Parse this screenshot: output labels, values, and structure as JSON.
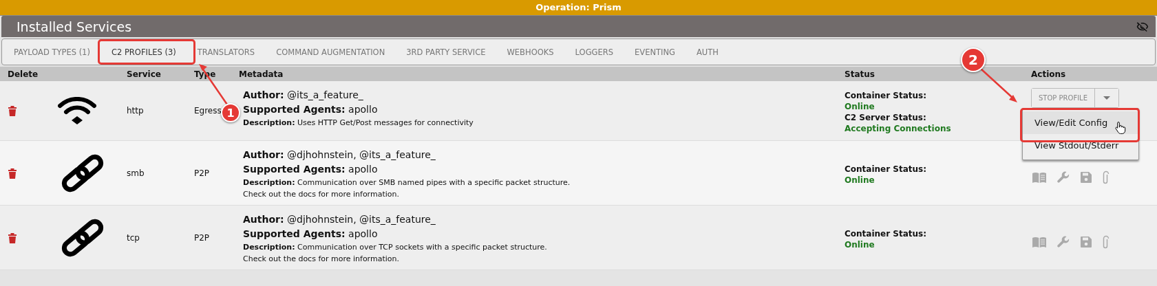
{
  "banner": {
    "title": "Operation: Prism"
  },
  "header": {
    "title": "Installed Services"
  },
  "tabs": [
    {
      "label": "PAYLOAD TYPES (1)",
      "selected": false
    },
    {
      "label": "C2 PROFILES (3)",
      "selected": true
    },
    {
      "label": "TRANSLATORS",
      "selected": false
    },
    {
      "label": "COMMAND AUGMENTATION",
      "selected": false
    },
    {
      "label": "3RD PARTY SERVICE",
      "selected": false
    },
    {
      "label": "WEBHOOKS",
      "selected": false
    },
    {
      "label": "LOGGERS",
      "selected": false
    },
    {
      "label": "EVENTING",
      "selected": false
    },
    {
      "label": "AUTH",
      "selected": false
    }
  ],
  "table": {
    "columns": [
      "Delete",
      "",
      "Service",
      "Type",
      "Metadata",
      "Status",
      "Actions"
    ],
    "rows": [
      {
        "kind": "wifi",
        "service": "http",
        "type": "Egress",
        "labels": {
          "author": "Author:",
          "agents": "Supported Agents:",
          "description": "Description:"
        },
        "author": "@its_a_feature_",
        "agents": "apollo",
        "description": [
          "Uses HTTP Get/Post messages for connectivity"
        ],
        "status": [
          {
            "label": "Container Status:",
            "value": "Online"
          },
          {
            "label": "C2 Server Status:",
            "value": "Accepting Connections"
          }
        ],
        "actions": {
          "kind": "dropdown",
          "label": "STOP PROFILE",
          "menu": [
            {
              "label": "View/Edit Config",
              "selected": true
            },
            {
              "label": "View Stdout/Stderr",
              "selected": false
            }
          ]
        }
      },
      {
        "kind": "link",
        "service": "smb",
        "type": "P2P",
        "labels": {
          "author": "Author:",
          "agents": "Supported Agents:",
          "description": "Description:"
        },
        "author": "@djhohnstein, @its_a_feature_",
        "agents": "apollo",
        "description": [
          "Communication over SMB named pipes with a specific packet structure.",
          "Check out the docs for more information."
        ],
        "status": [
          {
            "label": "Container Status:",
            "value": "Online"
          }
        ],
        "actions": {
          "kind": "icons"
        }
      },
      {
        "kind": "link",
        "service": "tcp",
        "type": "P2P",
        "labels": {
          "author": "Author:",
          "agents": "Supported Agents:",
          "description": "Description:"
        },
        "author": "@djhohnstein, @its_a_feature_",
        "agents": "apollo",
        "description": [
          "Communication over TCP sockets with a specific packet structure.",
          "Check out the docs for more information."
        ],
        "status": [
          {
            "label": "Container Status:",
            "value": "Online"
          }
        ],
        "actions": {
          "kind": "icons"
        }
      }
    ]
  },
  "annotations": [
    {
      "label": "1"
    },
    {
      "label": "2"
    }
  ]
}
